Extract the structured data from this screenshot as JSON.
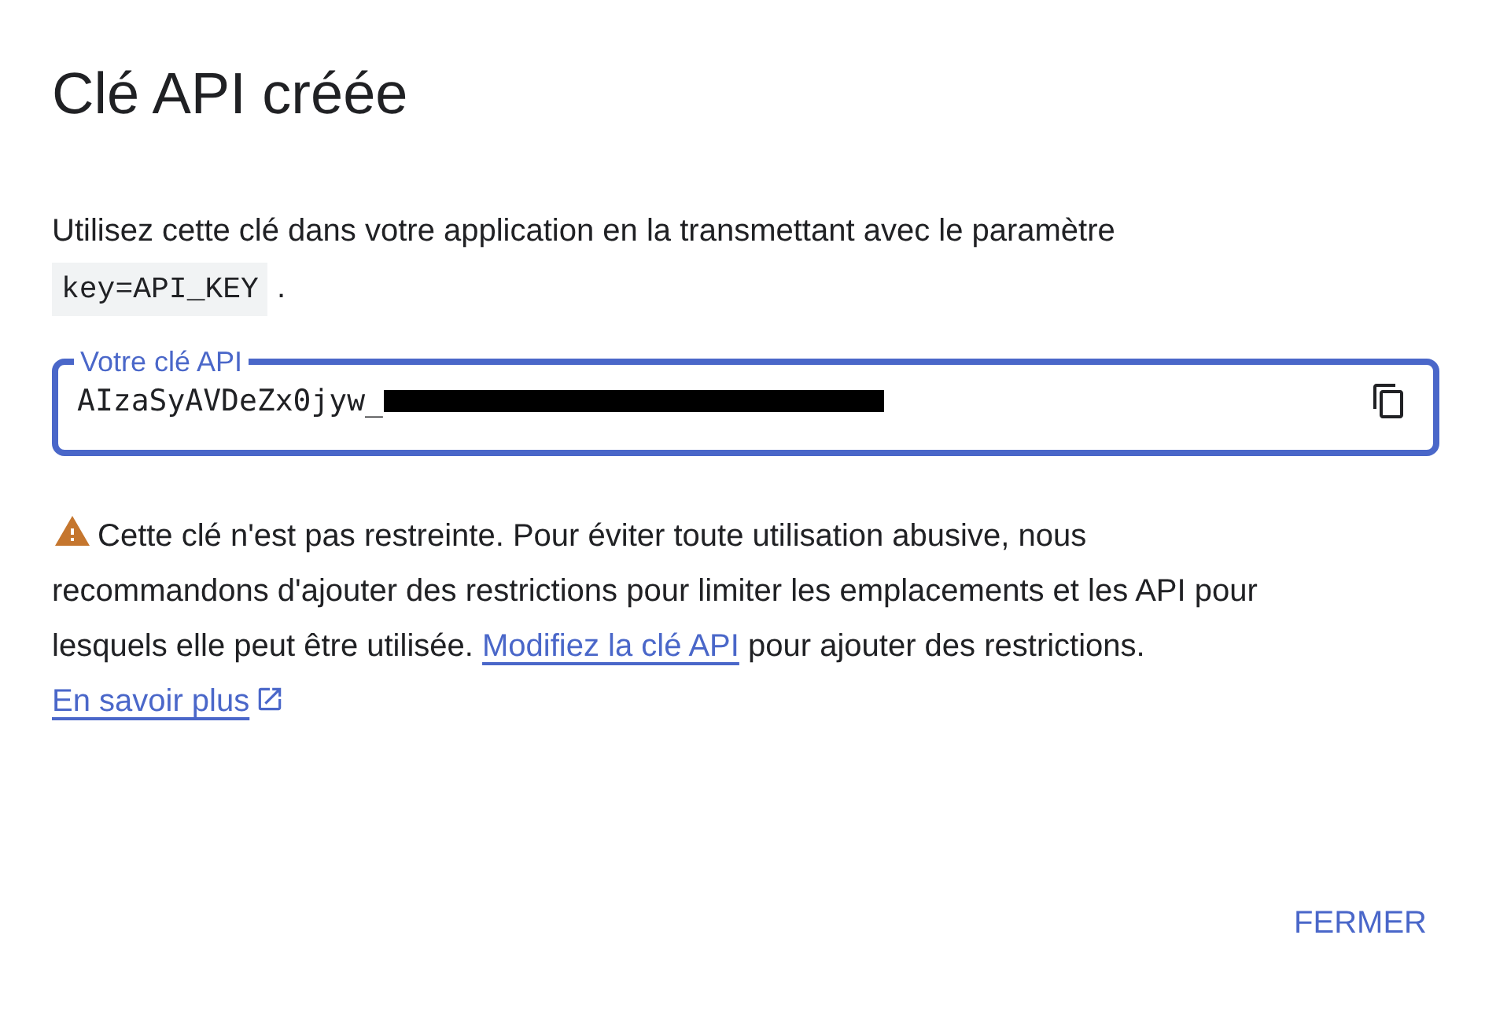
{
  "dialog": {
    "title": "Clé API créée",
    "intro": {
      "text": "Utilisez cette clé dans votre application en la transmettant avec le paramètre",
      "code": "key=API_KEY",
      "suffix": "."
    },
    "key_field": {
      "label": "Votre clé API",
      "value": "AIzaSyAVDeZx0jyw_",
      "redacted": true
    },
    "warning": {
      "text": "Cette clé n'est pas restreinte. Pour éviter toute utilisation abusive, nous recommandons d'ajouter des restrictions pour limiter les emplacements et les API pour lesquels elle peut être utilisée.",
      "link": "Modifiez la clé API",
      "text_after": "pour ajouter des restrictions.",
      "learn_more": "En savoir plus"
    },
    "buttons": [
      "FERMER"
    ]
  }
}
